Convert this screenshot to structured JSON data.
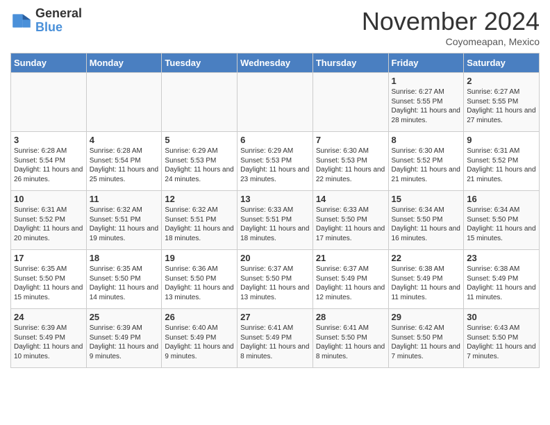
{
  "header": {
    "logo_general": "General",
    "logo_blue": "Blue",
    "month": "November 2024",
    "location": "Coyomeapan, Mexico"
  },
  "days_of_week": [
    "Sunday",
    "Monday",
    "Tuesday",
    "Wednesday",
    "Thursday",
    "Friday",
    "Saturday"
  ],
  "weeks": [
    [
      {
        "day": "",
        "info": ""
      },
      {
        "day": "",
        "info": ""
      },
      {
        "day": "",
        "info": ""
      },
      {
        "day": "",
        "info": ""
      },
      {
        "day": "",
        "info": ""
      },
      {
        "day": "1",
        "info": "Sunrise: 6:27 AM\nSunset: 5:55 PM\nDaylight: 11 hours\nand 28 minutes."
      },
      {
        "day": "2",
        "info": "Sunrise: 6:27 AM\nSunset: 5:55 PM\nDaylight: 11 hours\nand 27 minutes."
      }
    ],
    [
      {
        "day": "3",
        "info": "Sunrise: 6:28 AM\nSunset: 5:54 PM\nDaylight: 11 hours\nand 26 minutes."
      },
      {
        "day": "4",
        "info": "Sunrise: 6:28 AM\nSunset: 5:54 PM\nDaylight: 11 hours\nand 25 minutes."
      },
      {
        "day": "5",
        "info": "Sunrise: 6:29 AM\nSunset: 5:53 PM\nDaylight: 11 hours\nand 24 minutes."
      },
      {
        "day": "6",
        "info": "Sunrise: 6:29 AM\nSunset: 5:53 PM\nDaylight: 11 hours\nand 23 minutes."
      },
      {
        "day": "7",
        "info": "Sunrise: 6:30 AM\nSunset: 5:53 PM\nDaylight: 11 hours\nand 22 minutes."
      },
      {
        "day": "8",
        "info": "Sunrise: 6:30 AM\nSunset: 5:52 PM\nDaylight: 11 hours\nand 21 minutes."
      },
      {
        "day": "9",
        "info": "Sunrise: 6:31 AM\nSunset: 5:52 PM\nDaylight: 11 hours\nand 21 minutes."
      }
    ],
    [
      {
        "day": "10",
        "info": "Sunrise: 6:31 AM\nSunset: 5:52 PM\nDaylight: 11 hours\nand 20 minutes."
      },
      {
        "day": "11",
        "info": "Sunrise: 6:32 AM\nSunset: 5:51 PM\nDaylight: 11 hours\nand 19 minutes."
      },
      {
        "day": "12",
        "info": "Sunrise: 6:32 AM\nSunset: 5:51 PM\nDaylight: 11 hours\nand 18 minutes."
      },
      {
        "day": "13",
        "info": "Sunrise: 6:33 AM\nSunset: 5:51 PM\nDaylight: 11 hours\nand 18 minutes."
      },
      {
        "day": "14",
        "info": "Sunrise: 6:33 AM\nSunset: 5:50 PM\nDaylight: 11 hours\nand 17 minutes."
      },
      {
        "day": "15",
        "info": "Sunrise: 6:34 AM\nSunset: 5:50 PM\nDaylight: 11 hours\nand 16 minutes."
      },
      {
        "day": "16",
        "info": "Sunrise: 6:34 AM\nSunset: 5:50 PM\nDaylight: 11 hours\nand 15 minutes."
      }
    ],
    [
      {
        "day": "17",
        "info": "Sunrise: 6:35 AM\nSunset: 5:50 PM\nDaylight: 11 hours\nand 15 minutes."
      },
      {
        "day": "18",
        "info": "Sunrise: 6:35 AM\nSunset: 5:50 PM\nDaylight: 11 hours\nand 14 minutes."
      },
      {
        "day": "19",
        "info": "Sunrise: 6:36 AM\nSunset: 5:50 PM\nDaylight: 11 hours\nand 13 minutes."
      },
      {
        "day": "20",
        "info": "Sunrise: 6:37 AM\nSunset: 5:50 PM\nDaylight: 11 hours\nand 13 minutes."
      },
      {
        "day": "21",
        "info": "Sunrise: 6:37 AM\nSunset: 5:49 PM\nDaylight: 11 hours\nand 12 minutes."
      },
      {
        "day": "22",
        "info": "Sunrise: 6:38 AM\nSunset: 5:49 PM\nDaylight: 11 hours\nand 11 minutes."
      },
      {
        "day": "23",
        "info": "Sunrise: 6:38 AM\nSunset: 5:49 PM\nDaylight: 11 hours\nand 11 minutes."
      }
    ],
    [
      {
        "day": "24",
        "info": "Sunrise: 6:39 AM\nSunset: 5:49 PM\nDaylight: 11 hours\nand 10 minutes."
      },
      {
        "day": "25",
        "info": "Sunrise: 6:39 AM\nSunset: 5:49 PM\nDaylight: 11 hours\nand 9 minutes."
      },
      {
        "day": "26",
        "info": "Sunrise: 6:40 AM\nSunset: 5:49 PM\nDaylight: 11 hours\nand 9 minutes."
      },
      {
        "day": "27",
        "info": "Sunrise: 6:41 AM\nSunset: 5:49 PM\nDaylight: 11 hours\nand 8 minutes."
      },
      {
        "day": "28",
        "info": "Sunrise: 6:41 AM\nSunset: 5:50 PM\nDaylight: 11 hours\nand 8 minutes."
      },
      {
        "day": "29",
        "info": "Sunrise: 6:42 AM\nSunset: 5:50 PM\nDaylight: 11 hours\nand 7 minutes."
      },
      {
        "day": "30",
        "info": "Sunrise: 6:43 AM\nSunset: 5:50 PM\nDaylight: 11 hours\nand 7 minutes."
      }
    ]
  ]
}
